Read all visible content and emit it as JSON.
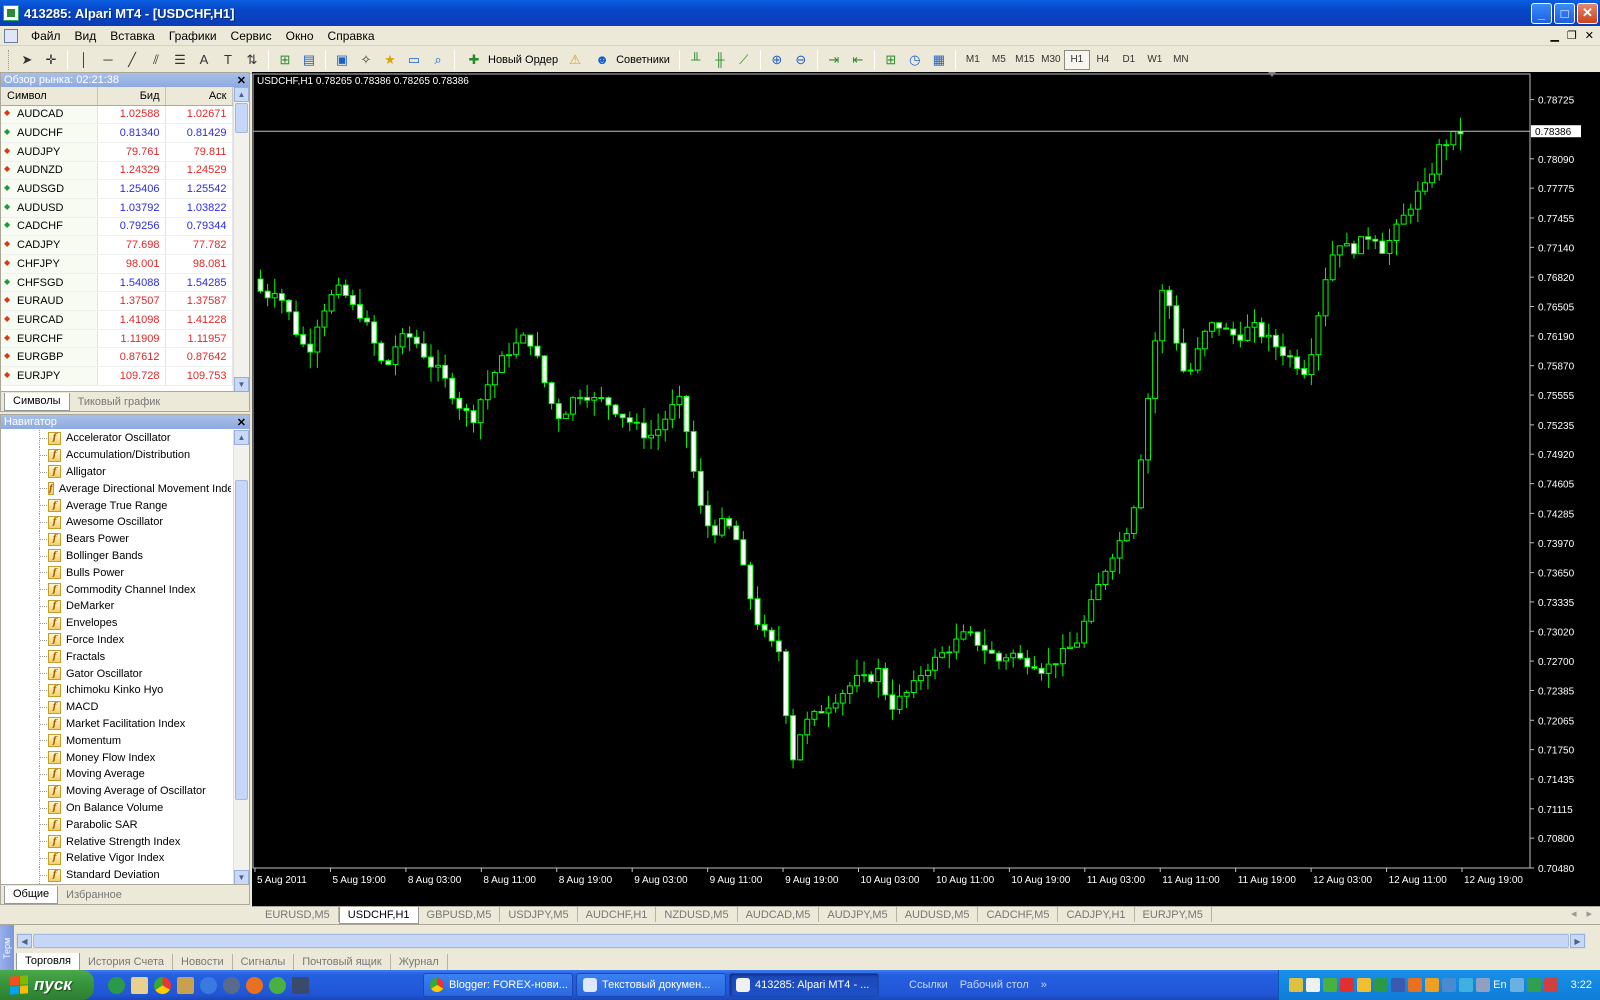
{
  "window": {
    "title": "413285: Alpari MT4 - [USDCHF,H1]",
    "minimize": "_",
    "maximize": "□",
    "close": "✕"
  },
  "menu": [
    "Файл",
    "Вид",
    "Вставка",
    "Графики",
    "Сервис",
    "Окно",
    "Справка"
  ],
  "toolbar": {
    "new_order": "Новый Ордер",
    "experts": "Советники",
    "timeframes": [
      "M1",
      "M5",
      "M15",
      "M30",
      "H1",
      "H4",
      "D1",
      "W1",
      "MN"
    ],
    "active_timeframe": "H1"
  },
  "market_watch": {
    "title": "Обзор рынка: 02:21:38",
    "columns": [
      "Символ",
      "Бид",
      "Аск"
    ],
    "rows": [
      {
        "symbol": "AUDCAD",
        "bid": "1.02588",
        "ask": "1.02671",
        "dir": "down"
      },
      {
        "symbol": "AUDCHF",
        "bid": "0.81340",
        "ask": "0.81429",
        "dir": "up"
      },
      {
        "symbol": "AUDJPY",
        "bid": "79.761",
        "ask": "79.811",
        "dir": "down"
      },
      {
        "symbol": "AUDNZD",
        "bid": "1.24329",
        "ask": "1.24529",
        "dir": "down"
      },
      {
        "symbol": "AUDSGD",
        "bid": "1.25406",
        "ask": "1.25542",
        "dir": "up"
      },
      {
        "symbol": "AUDUSD",
        "bid": "1.03792",
        "ask": "1.03822",
        "dir": "up"
      },
      {
        "symbol": "CADCHF",
        "bid": "0.79256",
        "ask": "0.79344",
        "dir": "up"
      },
      {
        "symbol": "CADJPY",
        "bid": "77.698",
        "ask": "77.782",
        "dir": "down"
      },
      {
        "symbol": "CHFJPY",
        "bid": "98.001",
        "ask": "98.081",
        "dir": "down"
      },
      {
        "symbol": "CHFSGD",
        "bid": "1.54088",
        "ask": "1.54285",
        "dir": "up"
      },
      {
        "symbol": "EURAUD",
        "bid": "1.37507",
        "ask": "1.37587",
        "dir": "down"
      },
      {
        "symbol": "EURCAD",
        "bid": "1.41098",
        "ask": "1.41228",
        "dir": "down"
      },
      {
        "symbol": "EURCHF",
        "bid": "1.11909",
        "ask": "1.11957",
        "dir": "down"
      },
      {
        "symbol": "EURGBP",
        "bid": "0.87612",
        "ask": "0.87642",
        "dir": "down"
      },
      {
        "symbol": "EURJPY",
        "bid": "109.728",
        "ask": "109.753",
        "dir": "down"
      }
    ],
    "tabs": [
      "Символы",
      "Тиковый график"
    ]
  },
  "navigator": {
    "title": "Навигатор",
    "items": [
      "Accelerator Oscillator",
      "Accumulation/Distribution",
      "Alligator",
      "Average Directional Movement Index",
      "Average True Range",
      "Awesome Oscillator",
      "Bears Power",
      "Bollinger Bands",
      "Bulls Power",
      "Commodity Channel Index",
      "DeMarker",
      "Envelopes",
      "Force Index",
      "Fractals",
      "Gator Oscillator",
      "Ichimoku Kinko Hyo",
      "MACD",
      "Market Facilitation Index",
      "Momentum",
      "Money Flow Index",
      "Moving Average",
      "Moving Average of Oscillator",
      "On Balance Volume",
      "Parabolic SAR",
      "Relative Strength Index",
      "Relative Vigor Index",
      "Standard Deviation"
    ],
    "tabs": [
      "Общие",
      "Избранное"
    ]
  },
  "chart_data": {
    "type": "candlestick",
    "header": "USDCHF,H1  0.78265 0.78386 0.78265 0.78386",
    "current_price": "0.78386",
    "y_ticks": [
      "0.78725",
      "0.78090",
      "0.77775",
      "0.77455",
      "0.77140",
      "0.76820",
      "0.76505",
      "0.76190",
      "0.75870",
      "0.75555",
      "0.75235",
      "0.74920",
      "0.74605",
      "0.74285",
      "0.73970",
      "0.73650",
      "0.73335",
      "0.73020",
      "0.72700",
      "0.72385",
      "0.72065",
      "0.71750",
      "0.71435",
      "0.71115",
      "0.70800",
      "0.70480"
    ],
    "ylim": [
      0.7048,
      0.79
    ],
    "x_ticks": [
      "5 Aug 2011",
      "5 Aug 19:00",
      "8 Aug 03:00",
      "8 Aug 11:00",
      "8 Aug 19:00",
      "9 Aug 03:00",
      "9 Aug 11:00",
      "9 Aug 19:00",
      "10 Aug 03:00",
      "10 Aug 11:00",
      "10 Aug 19:00",
      "11 Aug 03:00",
      "11 Aug 11:00",
      "11 Aug 19:00",
      "12 Aug 03:00",
      "12 Aug 11:00",
      "12 Aug 19:00"
    ],
    "candle_color": "#00ff00",
    "background": "#000000",
    "close_path": [
      0.768,
      0.766,
      0.767,
      0.765,
      0.762,
      0.76,
      0.764,
      0.766,
      0.767,
      0.765,
      0.764,
      0.761,
      0.758,
      0.761,
      0.762,
      0.761,
      0.759,
      0.758,
      0.756,
      0.754,
      0.753,
      0.756,
      0.758,
      0.76,
      0.761,
      0.762,
      0.759,
      0.755,
      0.753,
      0.755,
      0.756,
      0.755,
      0.755,
      0.754,
      0.753,
      0.752,
      0.751,
      0.752,
      0.754,
      0.755,
      0.748,
      0.742,
      0.741,
      0.742,
      0.74,
      0.735,
      0.731,
      0.729,
      0.728,
      0.716,
      0.72,
      0.721,
      0.722,
      0.723,
      0.724,
      0.725,
      0.725,
      0.726,
      0.722,
      0.723,
      0.724,
      0.726,
      0.727,
      0.728,
      0.729,
      0.73,
      0.729,
      0.728,
      0.727,
      0.728,
      0.727,
      0.727,
      0.726,
      0.727,
      0.728,
      0.729,
      0.732,
      0.735,
      0.738,
      0.74,
      0.742,
      0.75,
      0.76,
      0.768,
      0.762,
      0.757,
      0.76,
      0.763,
      0.763,
      0.762,
      0.762,
      0.763,
      0.762,
      0.761,
      0.76,
      0.759,
      0.758,
      0.764,
      0.77,
      0.772,
      0.771,
      0.772,
      0.773,
      0.771,
      0.773,
      0.775,
      0.777,
      0.778,
      0.782,
      0.783,
      0.7838
    ]
  },
  "chart_tabs": [
    "EURUSD,M5",
    "USDCHF,H1",
    "GBPUSD,M5",
    "USDJPY,M5",
    "AUDCHF,H1",
    "NZDUSD,M5",
    "AUDCAD,M5",
    "AUDJPY,M5",
    "AUDUSD,M5",
    "CADCHF,M5",
    "CADJPY,H1",
    "EURJPY,M5"
  ],
  "active_chart_tab": "USDCHF,H1",
  "terminal": {
    "side_label": "Терм",
    "tabs": [
      "Торговля",
      "История Счета",
      "Новости",
      "Сигналы",
      "Почтовый ящик",
      "Журнал"
    ]
  },
  "taskbar": {
    "start": "пуск",
    "tasks": [
      "Blogger: FOREX-нови...",
      "Текстовый докумен...",
      "413285: Alpari MT4 - ..."
    ],
    "links": [
      "Ссылки",
      "Рабочий стол"
    ],
    "lang": "En",
    "clock": "3:22"
  }
}
